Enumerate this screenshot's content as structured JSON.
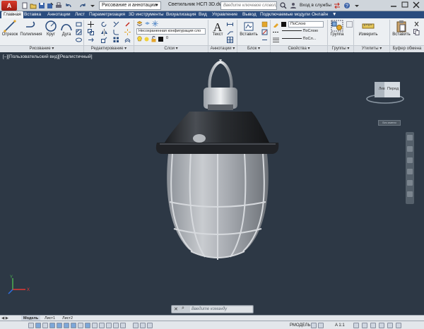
{
  "app": {
    "logo": "A",
    "window_title": "Светильник НСП 3D.dwg",
    "search_placeholder": "Введите ключевое слово/фразу",
    "login": "Вход в службы"
  },
  "workspace": {
    "value": "Рисование и аннотации"
  },
  "tabs": [
    {
      "label": "Главная",
      "active": true
    },
    {
      "label": "Вставка"
    },
    {
      "label": "Аннотации"
    },
    {
      "label": "Лист"
    },
    {
      "label": "Параметризация"
    },
    {
      "label": "3D инструменты"
    },
    {
      "label": "Визуализация"
    },
    {
      "label": "Вид"
    },
    {
      "label": "Управление"
    },
    {
      "label": "Вывод"
    },
    {
      "label": "Подключаемые модули"
    },
    {
      "label": "Онлайн"
    }
  ],
  "ribbon": {
    "draw": {
      "line": "Отрезок",
      "polyline": "Полилиния",
      "circle": "Круг",
      "arc": "Дуга",
      "panel": "Рисование ▾"
    },
    "modify": {
      "panel": "Редактирование ▾"
    },
    "layers": {
      "layer_state": "Несохраненная конфигурация сло",
      "current_layer": "0",
      "panel": "Слои ▾"
    },
    "annotation": {
      "text": "Текст",
      "panel": "Аннотации ▾"
    },
    "block": {
      "insert": "Вставить",
      "panel": "Блок ▾"
    },
    "properties": {
      "color": "ПоСлою",
      "linetype": "ПоСлою",
      "lineweight": "ПоСл...",
      "panel": "Свойства ▾"
    },
    "groups": {
      "group": "Группа",
      "panel": "Группы ▾"
    },
    "utilities": {
      "measure": "Измерить",
      "panel": "Утилиты ▾"
    },
    "clipboard": {
      "paste": "Вставить",
      "panel": "Буфер обмена"
    }
  },
  "viewport": {
    "label": "[–][Пользовательский вид][Реалистичный]",
    "viewcube_left": "Лев",
    "viewcube_front": "Перед",
    "wcs": "Без имени"
  },
  "command": {
    "placeholder": "Введите команду"
  },
  "layouts": [
    {
      "label": "Модель",
      "active": true
    },
    {
      "label": "Лист1"
    },
    {
      "label": "Лист2"
    }
  ],
  "status": {
    "mode": "РМОДЕЛЬ",
    "scale": "A 1:1"
  },
  "colors": {
    "viewport_bg": "#2d3845",
    "tab_strip": "#2a4c7e",
    "ribbon_bg": "#eceff2",
    "app_logo": "#c42a1d"
  }
}
